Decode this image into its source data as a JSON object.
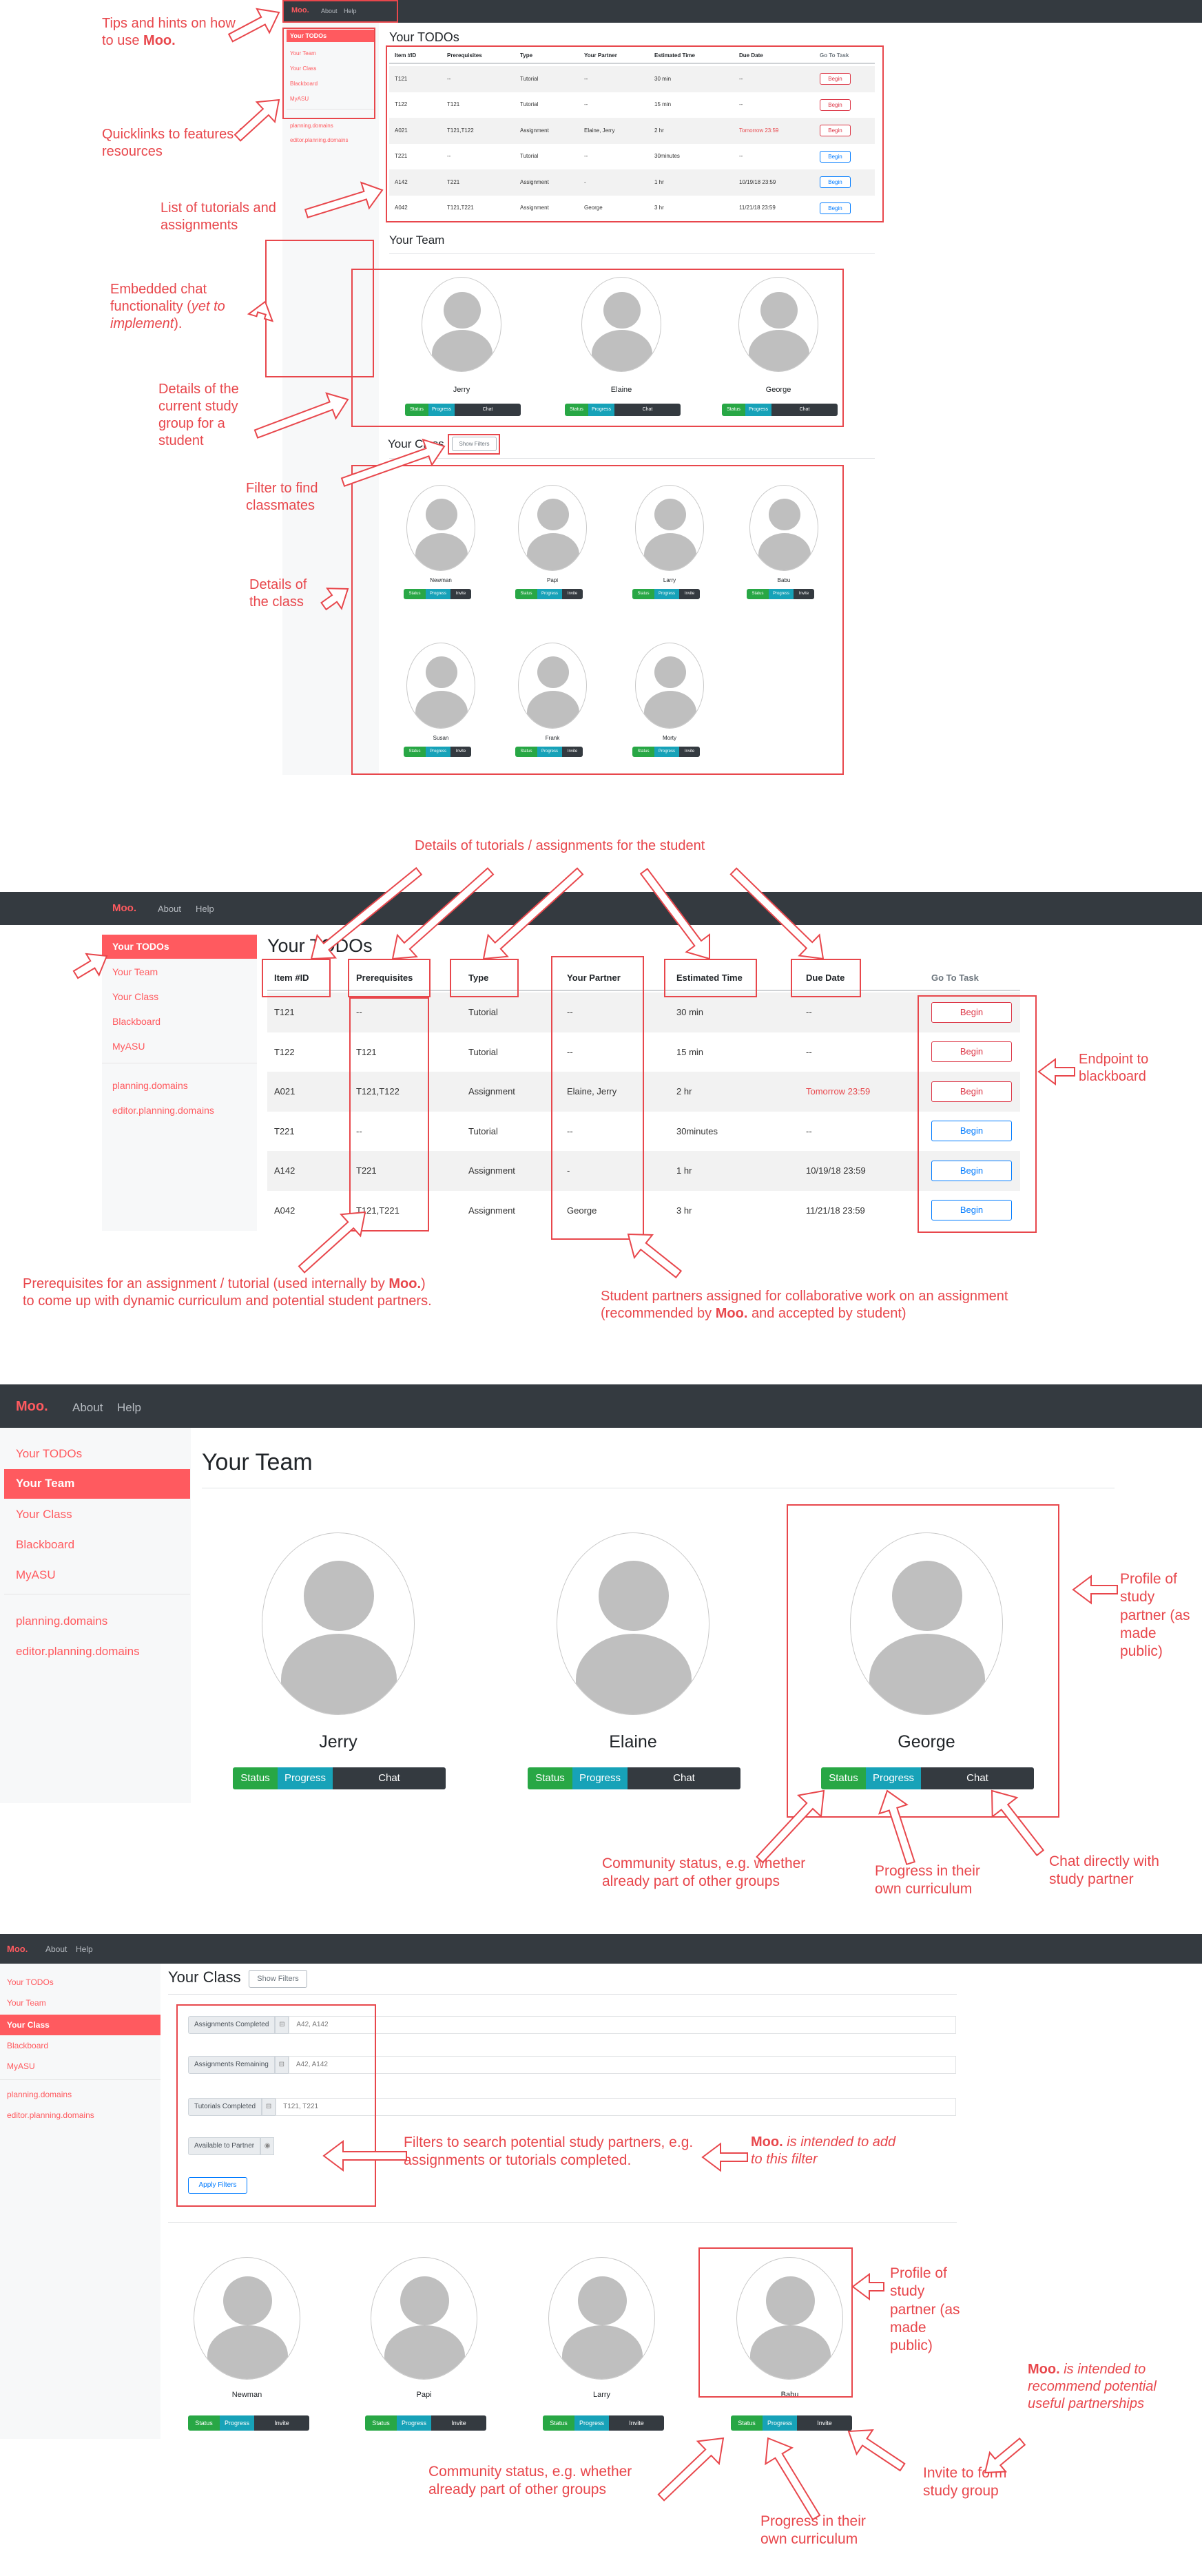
{
  "app": {
    "brand": "Moo.",
    "nav": [
      "About",
      "Help"
    ]
  },
  "sidebar": {
    "items": [
      "Your TODOs",
      "Your Team",
      "Your Class",
      "Blackboard",
      "MyASU"
    ],
    "links": [
      "planning.domains",
      "editor.planning.domains"
    ]
  },
  "todos": {
    "title": "Your TODOs",
    "columns": [
      "Item #ID",
      "Prerequisites",
      "Type",
      "Your Partner",
      "Estimated Time",
      "Due Date",
      "Go To Task"
    ],
    "rows": [
      {
        "id": "T121",
        "prereq": "--",
        "type": "Tutorial",
        "partner": "--",
        "time": "30 min",
        "due": "--",
        "button": "Begin",
        "style": "danger"
      },
      {
        "id": "T122",
        "prereq": "T121",
        "type": "Tutorial",
        "partner": "--",
        "time": "15 min",
        "due": "--",
        "button": "Begin",
        "style": "danger"
      },
      {
        "id": "A021",
        "prereq": "T121,T122",
        "type": "Assignment",
        "partner": "Elaine, Jerry",
        "time": "2 hr",
        "due": "Tomorrow 23:59",
        "button": "Begin",
        "style": "danger"
      },
      {
        "id": "T221",
        "prereq": "--",
        "type": "Tutorial",
        "partner": "--",
        "time": "30minutes",
        "due": "--",
        "button": "Begin",
        "style": "primary"
      },
      {
        "id": "A142",
        "prereq": "T221",
        "type": "Assignment",
        "partner": "-",
        "time": "1 hr",
        "due": "10/19/18 23:59",
        "button": "Begin",
        "style": "primary"
      },
      {
        "id": "A042",
        "prereq": "T121,T221",
        "type": "Assignment",
        "partner": "George",
        "time": "3 hr",
        "due": "11/21/18 23:59",
        "button": "Begin",
        "style": "primary"
      }
    ]
  },
  "team": {
    "title": "Your Team",
    "members": [
      "Jerry",
      "Elaine",
      "George"
    ],
    "buttons": [
      "Status",
      "Progress",
      "Chat"
    ]
  },
  "class": {
    "title": "Your Class",
    "filter_button": "Show Filters",
    "members": [
      "Newman",
      "Papi",
      "Larry",
      "Babu",
      "Susan",
      "Frank",
      "Morty"
    ],
    "buttons": [
      "Status",
      "Progress",
      "Invite"
    ],
    "filters": [
      {
        "label": "Assignments Completed",
        "value": "A42, A142"
      },
      {
        "label": "Assignments Remaining",
        "value": "A42, A142"
      },
      {
        "label": "Tutorials Completed",
        "value": "T121, T221"
      }
    ],
    "available_label": "Available to Partner",
    "apply_label": "Apply Filters"
  },
  "annotations": {
    "tips_pre": "Tips and hints on how to use ",
    "moo": "Moo.",
    "quicklinks": "Quicklinks to features / resources",
    "list": "List of tutorials and assignments",
    "chat_pre": "Embedded chat functionality (",
    "chat_em": "yet to implement",
    "chat_post": ").",
    "group": "Details of the current study group for a student",
    "filter": "Filter to find classmates",
    "class_details": "Details of the class",
    "todo_details": "Details of tutorials / assignments for the student",
    "endpoint": "Endpoint to blackboard",
    "prereq_1": "Prerequisites for an assignment / tutorial (used internally by ",
    "prereq_2": ")",
    "prereq_3": "to come up with dynamic curriculum and potential student partners.",
    "partners_1": "Student partners assigned for collaborative work on an assignment (recommended by ",
    "partners_2": " and accepted by student)",
    "profile": "Profile of study partner (as made public)",
    "community": "Community status, e.g. whether already part of other groups",
    "progress": "Progress in their own curriculum",
    "chat_direct": "Chat directly with study partner",
    "filters_desc": "Filters to search potential study partners, e.g. assignments or tutorials completed.",
    "intended_filter": " is intended to add to this filter",
    "profile2": "Profile of study partner (as made public)",
    "intended_recommend": " is intended to recommend potential useful partnerships",
    "invite": "Invite to form study group",
    "community2": "Community status, e.g. whether already part of other groups",
    "progress2": "Progress in their own curriculum"
  },
  "colors": {
    "accent": "#ff5a5f",
    "annotation": "#e8474c",
    "navbar": "#343a40",
    "status": "#28a745",
    "progress": "#17a2b8",
    "primary": "#007bff"
  }
}
